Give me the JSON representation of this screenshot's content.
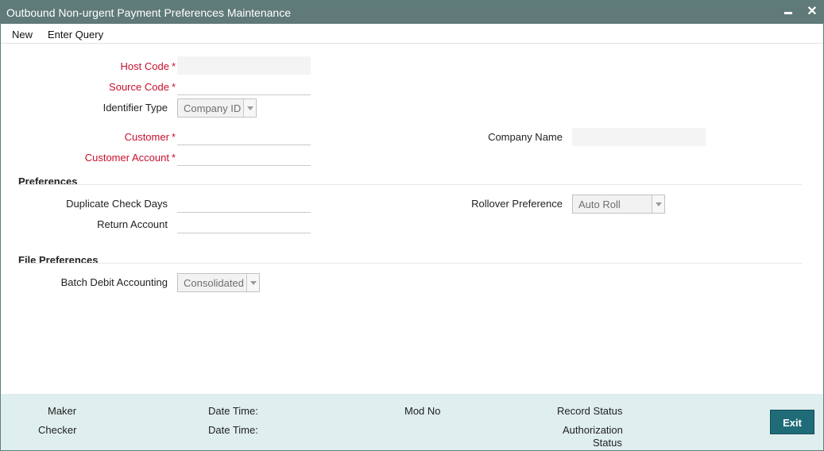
{
  "window": {
    "title": "Outbound Non-urgent Payment Preferences Maintenance",
    "close_glyph": "✕"
  },
  "menu": {
    "new_label": "New",
    "enter_query_label": "Enter Query"
  },
  "form": {
    "host_code": {
      "label": "Host Code",
      "value": ""
    },
    "source_code": {
      "label": "Source Code",
      "value": ""
    },
    "identifier_type": {
      "label": "Identifier Type",
      "value": "Company ID"
    },
    "customer": {
      "label": "Customer",
      "value": ""
    },
    "customer_account": {
      "label": "Customer Account",
      "value": ""
    },
    "company_name": {
      "label": "Company Name",
      "value": ""
    },
    "required_mark": "*"
  },
  "preferences": {
    "heading": "Preferences",
    "duplicate_check_days": {
      "label": "Duplicate Check Days",
      "value": ""
    },
    "return_account": {
      "label": "Return Account",
      "value": ""
    },
    "rollover_preference": {
      "label": "Rollover Preference",
      "value": "Auto Roll"
    }
  },
  "file_preferences": {
    "heading": "File Preferences",
    "batch_debit_accounting": {
      "label": "Batch Debit Accounting",
      "value": "Consolidated"
    }
  },
  "footer": {
    "maker_label": "Maker",
    "checker_label": "Checker",
    "maker_date_time_label": "Date Time:",
    "checker_date_time_label": "Date Time:",
    "mod_no_label": "Mod No",
    "record_status_label": "Record Status",
    "authorization_status_line1": "Authorization",
    "authorization_status_line2": "Status",
    "exit_label": "Exit"
  },
  "colors": {
    "titlebar": "#5f7a78",
    "required": "#c8102e",
    "footer": "#dfeeee",
    "exit_button": "#1f6c78"
  }
}
